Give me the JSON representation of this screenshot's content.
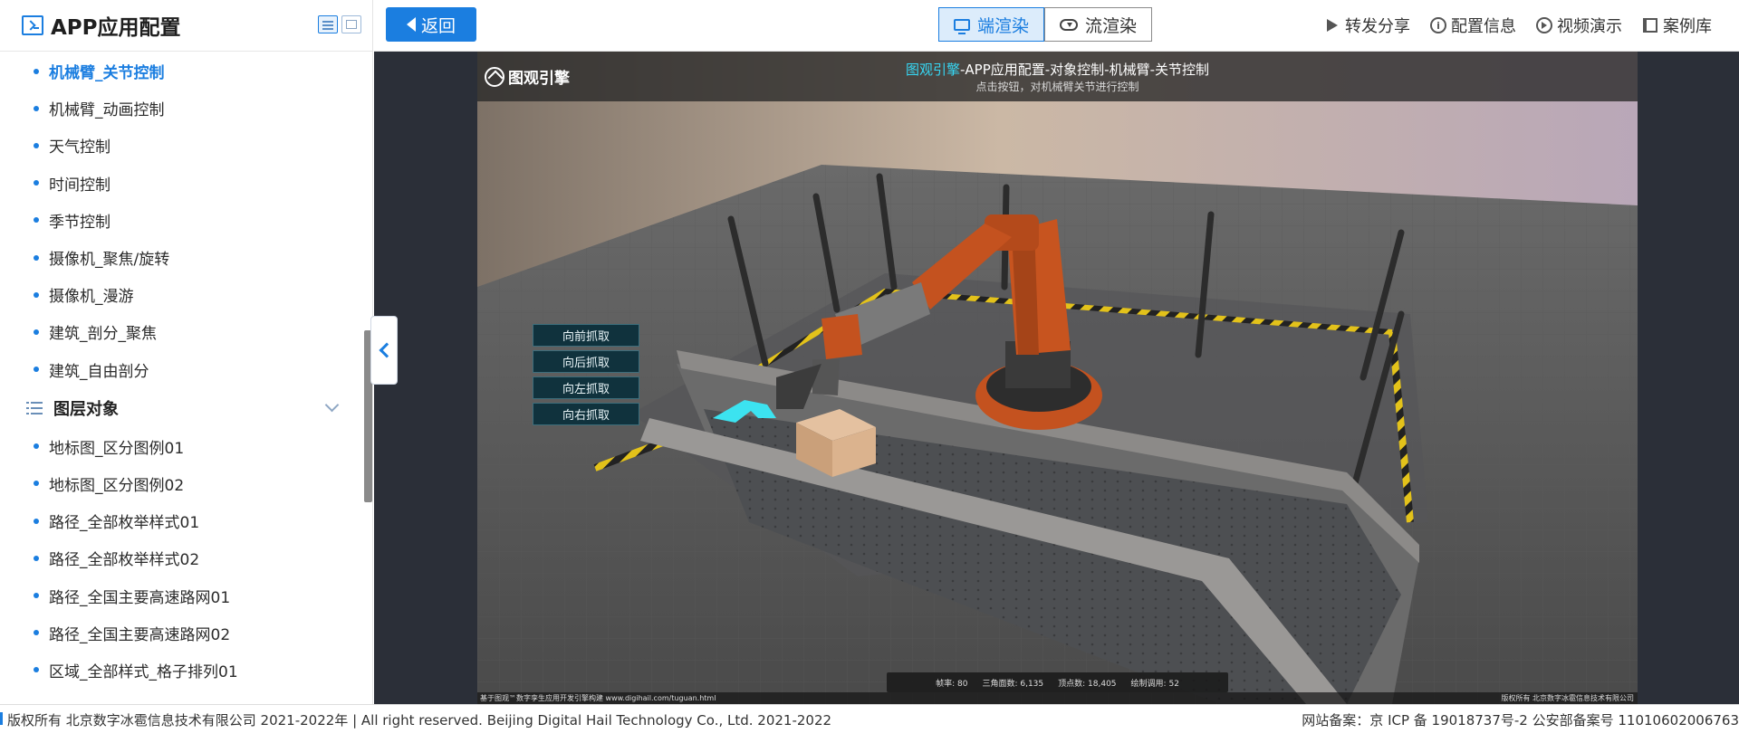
{
  "sidebar": {
    "title": "APP应用配置",
    "items_top": [
      {
        "label": "机械臂_关节控制",
        "active": true
      },
      {
        "label": "机械臂_动画控制"
      },
      {
        "label": "天气控制"
      },
      {
        "label": "时间控制"
      },
      {
        "label": "季节控制"
      },
      {
        "label": "摄像机_聚焦/旋转"
      },
      {
        "label": "摄像机_漫游"
      },
      {
        "label": "建筑_剖分_聚焦"
      },
      {
        "label": "建筑_自由剖分"
      }
    ],
    "group": {
      "label": "图层对象"
    },
    "items_bottom": [
      {
        "label": "地标图_区分图例01"
      },
      {
        "label": "地标图_区分图例02"
      },
      {
        "label": "路径_全部枚举样式01"
      },
      {
        "label": "路径_全部枚举样式02"
      },
      {
        "label": "路径_全国主要高速路网01"
      },
      {
        "label": "路径_全国主要高速路网02"
      },
      {
        "label": "区域_全部样式_格子排列01"
      }
    ]
  },
  "topbar": {
    "back_label": "返回",
    "render_modes": [
      {
        "label": "端渲染",
        "active": true
      },
      {
        "label": "流渲染"
      }
    ],
    "actions": [
      {
        "label": "转发分享",
        "icon": "share-icon"
      },
      {
        "label": "配置信息",
        "icon": "info-icon"
      },
      {
        "label": "视频演示",
        "icon": "play-icon"
      },
      {
        "label": "案例库",
        "icon": "library-icon"
      }
    ]
  },
  "scene": {
    "brand": "图观引擎",
    "title_highlight": "图观引擎",
    "title_rest": "-APP应用配置-对象控制-机械臂-关节控制",
    "subtitle": "点击按钮，对机械臂关节进行控制",
    "controls": [
      "向前抓取",
      "向后抓取",
      "向左抓取",
      "向右抓取"
    ],
    "stats": {
      "fps_label": "帧率:",
      "fps": "80",
      "tri_label": "三角面数:",
      "tri": "6,135",
      "vert_label": "顶点数:",
      "vert": "18,405",
      "draw_label": "绘制调用:",
      "draw": "52"
    },
    "footer_left": "基于图观™数字孪生应用开发引擎构建 www.digihail.com/tuguan.html",
    "footer_right": "版权所有 北京数字冰雹信息技术有限公司"
  },
  "footer": {
    "copyright": "版权所有 北京数字冰雹信息技术有限公司 2021-2022年 | All right reserved. Beijing Digital Hail Technology Co., Ltd. 2021-2022",
    "icp": "网站备案：京 ICP 备 19018737号-2 公安部备案号 11010602006763"
  }
}
